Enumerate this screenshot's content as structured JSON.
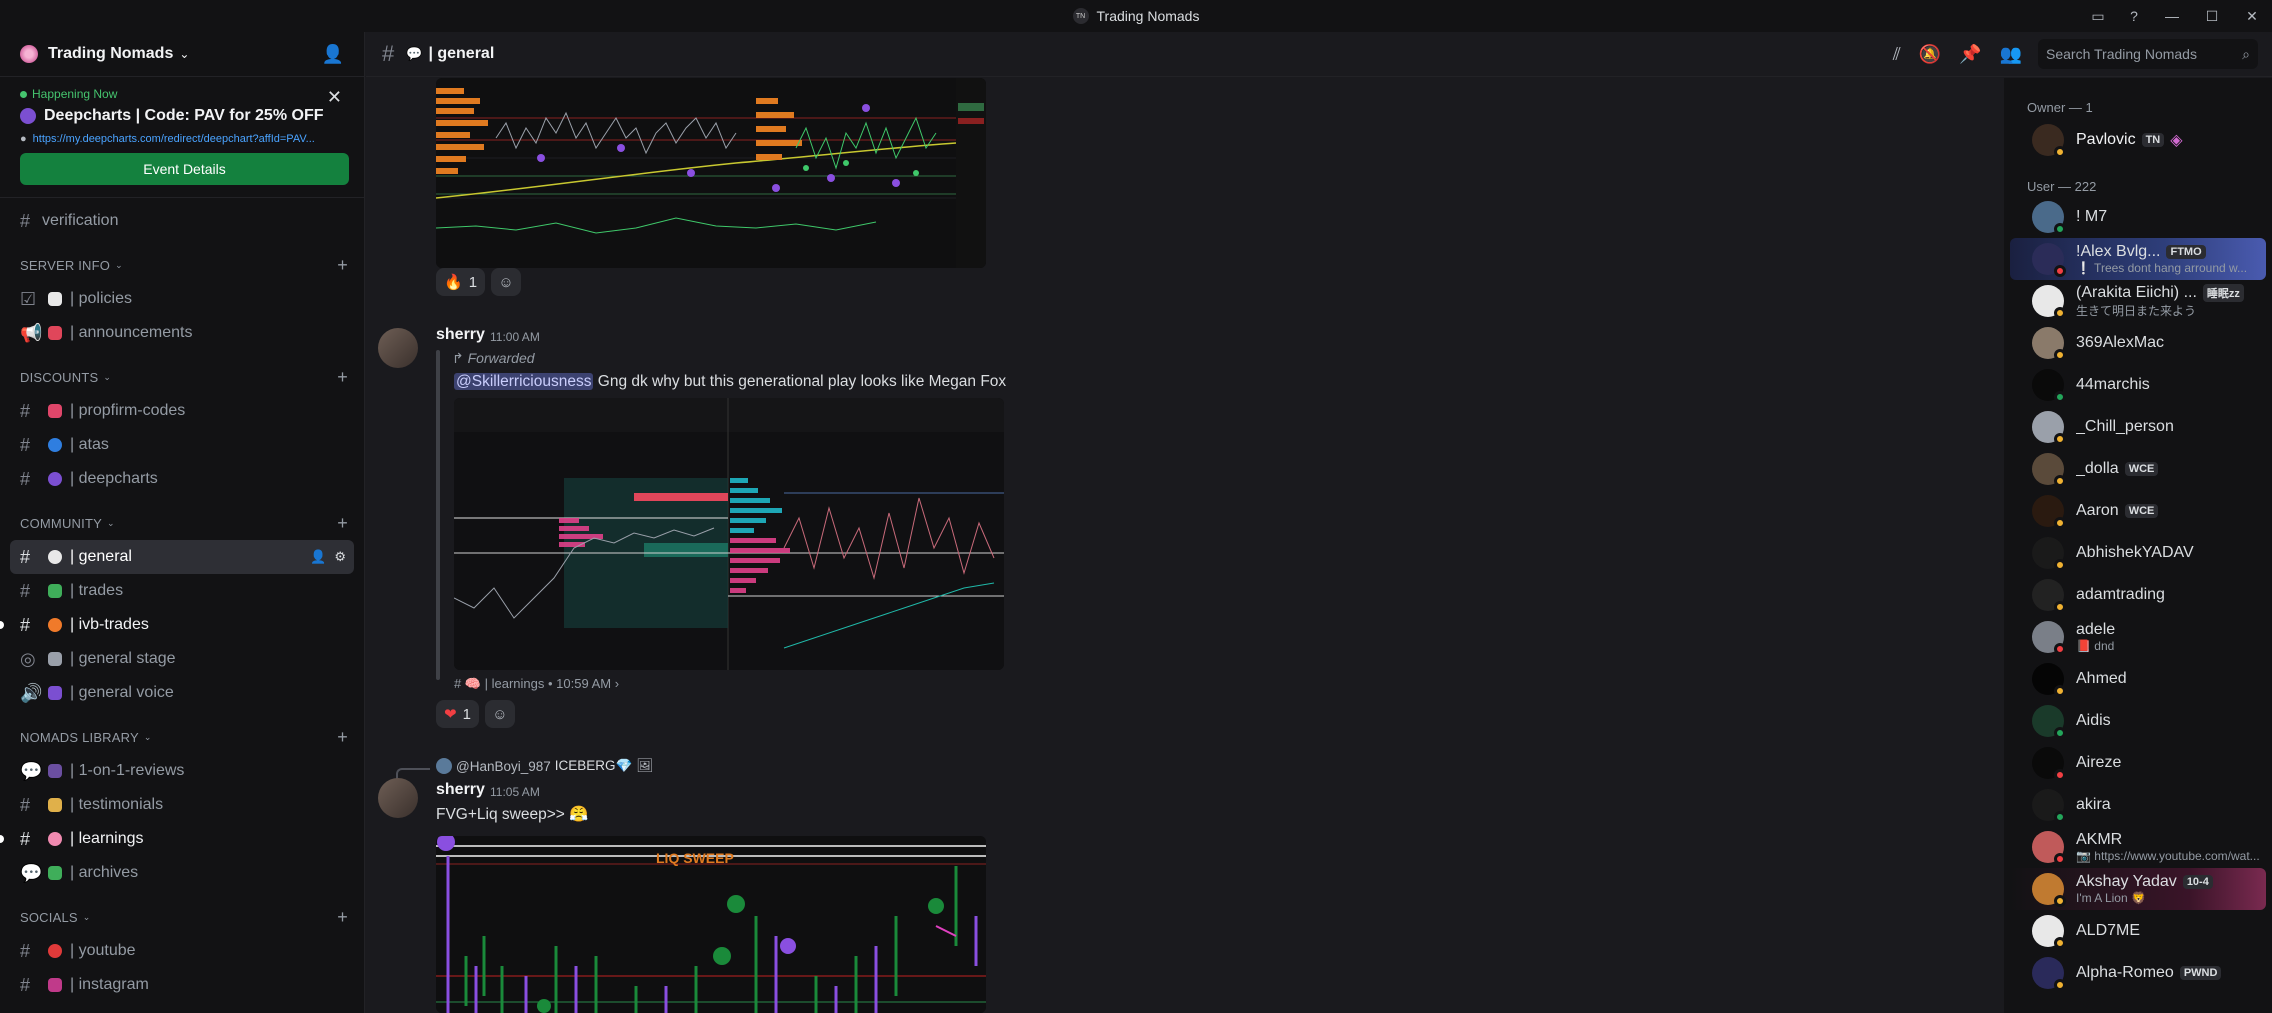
{
  "window": {
    "title": "Trading Nomads",
    "badge": "TN"
  },
  "server": {
    "name": "Trading Nomads"
  },
  "event": {
    "status": "Happening Now",
    "title": "Deepcharts | Code: PAV for 25% OFF",
    "link": "https://my.deepcharts.com/redirect/deepchart?affId=PAV...",
    "button": "Event Details"
  },
  "channels": {
    "verification": "verification",
    "categories": {
      "server_info": "SERVER INFO",
      "discounts": "DISCOUNTS",
      "community": "COMMUNITY",
      "library": "NOMADS LIBRARY",
      "socials": "SOCIALS"
    },
    "policies": "| policies",
    "announcements": "| announcements",
    "propfirm": "| propfirm-codes",
    "atas": "| atas",
    "deepcharts": "| deepcharts",
    "general": "| general",
    "trades": "| trades",
    "ivb": "| ivb-trades",
    "stage": "| general stage",
    "voice": "| general voice",
    "reviews": "| 1-on-1-reviews",
    "testimonials": "| testimonials",
    "learnings": "| learnings",
    "archives": "| archives",
    "youtube": "| youtube",
    "instagram": "| instagram"
  },
  "header": {
    "channel": "| general",
    "search_placeholder": "Search Trading Nomads"
  },
  "messages": {
    "r1_count": "1",
    "m1_author": "sherry",
    "m1_time": "11:00 AM",
    "m1_forwarded": "Forwarded",
    "m1_mention": "@Skillerriciousness",
    "m1_text": " Gng dk why but this generational play looks like Megan Fox",
    "m1_source": "# 🧠 | learnings • 10:59 AM  ›",
    "r2_count": "1",
    "reply_user": "@HanBoyi_987",
    "reply_text": "ICEBERG💎",
    "m2_author": "sherry",
    "m2_time": "11:05 AM",
    "m2_text": "FVG+Liq sweep>> 😤",
    "chart_label": "LIQ SWEEP"
  },
  "members": {
    "owner_header": "Owner — 1",
    "user_header": "User — 222",
    "owner": {
      "name": "Pavlovic",
      "tag": "TN"
    },
    "list": [
      {
        "name": "! M7",
        "sub": "",
        "tag": "",
        "status": "online",
        "color": "#4a6a8a"
      },
      {
        "name": "!Alex Bvlg...",
        "sub": "❕ Trees dont hang arround w...",
        "tag": "FTMO",
        "status": "dnd",
        "color": "#2b2c58"
      },
      {
        "name": "(Arakita Eiichi) ...",
        "sub": "生きて明日また来よう",
        "tag": "睡眠zz",
        "status": "idle",
        "color": "#e8e8e8"
      },
      {
        "name": "369AlexMac",
        "sub": "",
        "tag": "",
        "status": "idle",
        "color": "#8a7a6a"
      },
      {
        "name": "44marchis",
        "sub": "",
        "tag": "",
        "status": "online",
        "color": "#0a0a0a"
      },
      {
        "name": "_Chill_person",
        "sub": "",
        "tag": "",
        "status": "idle",
        "color": "#9aa0aa"
      },
      {
        "name": "_dolla",
        "sub": "",
        "tag": "WCE",
        "status": "idle",
        "color": "#5a4a3a"
      },
      {
        "name": "Aaron",
        "sub": "",
        "tag": "WCE",
        "status": "idle",
        "color": "#2a1a10"
      },
      {
        "name": "AbhishekYADAV",
        "sub": "",
        "tag": "",
        "status": "idle",
        "color": "#1a1a1a"
      },
      {
        "name": "adamtrading",
        "sub": "",
        "tag": "",
        "status": "idle",
        "color": "#222"
      },
      {
        "name": "adele",
        "sub": "📕 dnd",
        "tag": "",
        "status": "dnd",
        "color": "#7a7f88"
      },
      {
        "name": "Ahmed",
        "sub": "",
        "tag": "",
        "status": "idle",
        "color": "#050505"
      },
      {
        "name": "Aidis",
        "sub": "",
        "tag": "",
        "status": "online",
        "color": "#1a3a2a"
      },
      {
        "name": "Aireze",
        "sub": "",
        "tag": "",
        "status": "dnd",
        "color": "#0a0a0a"
      },
      {
        "name": "akira",
        "sub": "",
        "tag": "",
        "status": "online",
        "color": "#1a1a1a"
      },
      {
        "name": "AKMR",
        "sub": "📷 https://www.youtube.com/wat...",
        "tag": "",
        "status": "dnd",
        "color": "#c05a5a"
      },
      {
        "name": "Akshay Yadav",
        "sub": "I'm A Lion 🦁",
        "tag": "10-4",
        "status": "idle",
        "color": "#c07a30"
      },
      {
        "name": "ALD7ME",
        "sub": "",
        "tag": "",
        "status": "idle",
        "color": "#e8e8e8"
      },
      {
        "name": "Alpha-Romeo",
        "sub": "",
        "tag": "PWND",
        "status": "idle",
        "color": "#2a2a5a"
      }
    ]
  }
}
